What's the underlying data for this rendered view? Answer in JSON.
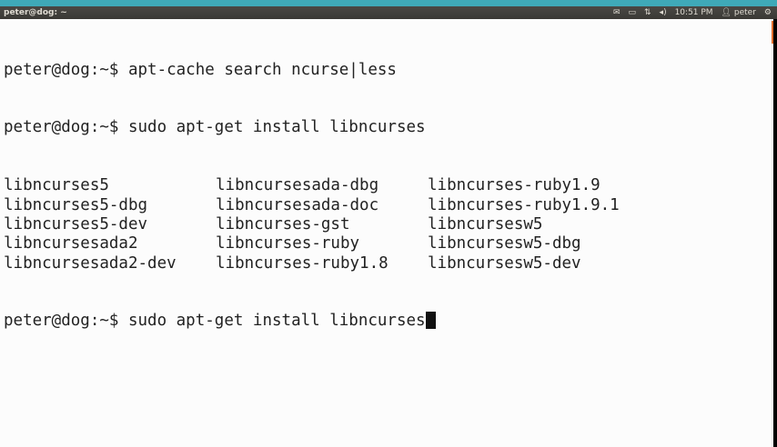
{
  "panel": {
    "window_title": "peter@dog: ~",
    "clock": "10:51 PM",
    "user": "peter",
    "icons": [
      "mail-icon",
      "battery-icon",
      "network-icon",
      "volume-icon",
      "user-icon",
      "gear-icon"
    ]
  },
  "terminal": {
    "lines": [
      "peter@dog:~$ apt-cache search ncurse|less",
      "peter@dog:~$ sudo apt-get install libncurses"
    ],
    "completions": [
      [
        "libncurses5",
        "libncursesada-dbg",
        "libncurses-ruby1.9"
      ],
      [
        "libncurses5-dbg",
        "libncursesada-doc",
        "libncurses-ruby1.9.1"
      ],
      [
        "libncurses5-dev",
        "libncurses-gst",
        "libncursesw5"
      ],
      [
        "libncursesada2",
        "libncurses-ruby",
        "libncursesw5-dbg"
      ],
      [
        "libncursesada2-dev",
        "libncurses-ruby1.8",
        "libncursesw5-dev"
      ]
    ],
    "current_prompt": "peter@dog:~$ sudo apt-get install libncurses"
  },
  "colors": {
    "accent": "#e06d2c",
    "top_strip": "#3fa9b8",
    "panel": "#3a3935"
  }
}
